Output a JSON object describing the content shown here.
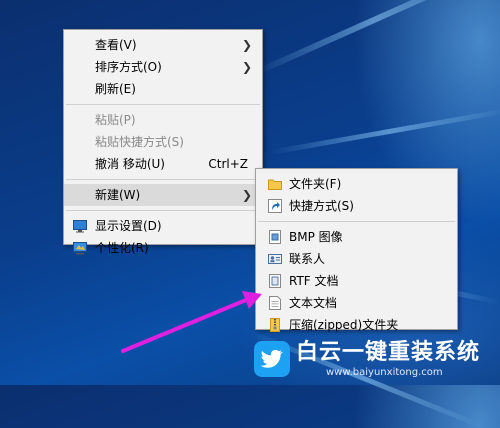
{
  "context_menu": {
    "items": [
      {
        "label": "查看(V)",
        "submenu": true
      },
      {
        "label": "排序方式(O)",
        "submenu": true
      },
      {
        "label": "刷新(E)"
      },
      {
        "label": "粘贴(P)",
        "disabled": true
      },
      {
        "label": "粘贴快捷方式(S)",
        "disabled": true
      },
      {
        "label": "撤消 移动(U)",
        "shortcut": "Ctrl+Z"
      },
      {
        "label": "新建(W)",
        "submenu": true,
        "highlighted": true
      },
      {
        "label": "显示设置(D)",
        "icon": "display-settings-icon"
      },
      {
        "label": "个性化(R)",
        "icon": "personalize-icon"
      }
    ]
  },
  "new_submenu": {
    "items": [
      {
        "label": "文件夹(F)",
        "icon": "folder-icon"
      },
      {
        "label": "快捷方式(S)",
        "icon": "shortcut-icon"
      },
      {
        "label": "BMP 图像",
        "icon": "bmp-image-icon"
      },
      {
        "label": "联系人",
        "icon": "contact-icon"
      },
      {
        "label": "RTF 文档",
        "icon": "rtf-document-icon"
      },
      {
        "label": "文本文档",
        "icon": "text-document-icon"
      },
      {
        "label": "压缩(zipped)文件夹",
        "icon": "zip-folder-icon"
      }
    ]
  },
  "watermark": {
    "brand": "白云一键重装系统",
    "url": "www.baiyunxitong.com",
    "icon": "twitter-bird-icon"
  },
  "colors": {
    "arrow": "#e020e0",
    "menu_bg": "#f2f2f2",
    "highlight": "#dadada",
    "brand_blue": "#1da1f2"
  }
}
